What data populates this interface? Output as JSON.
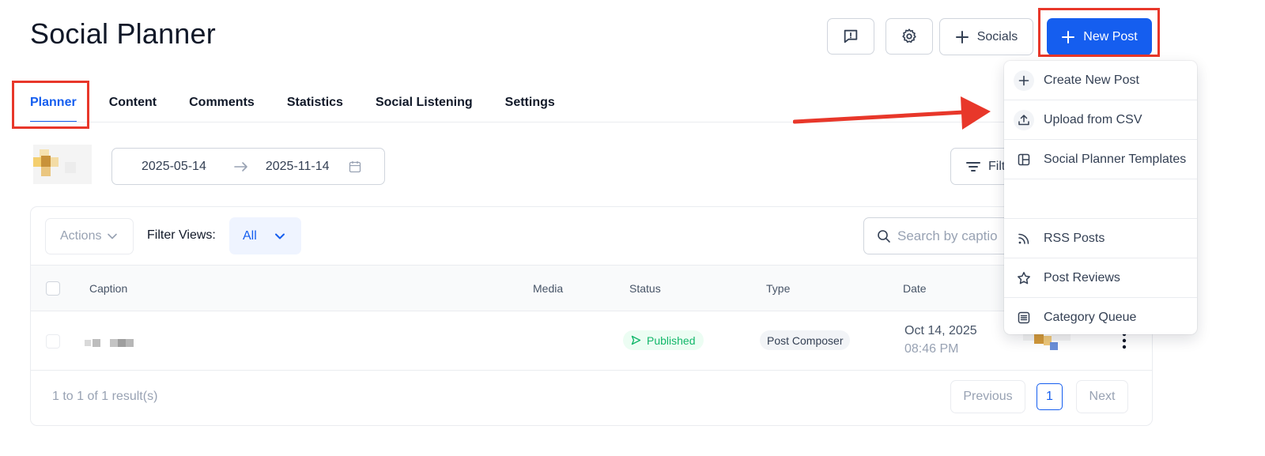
{
  "header": {
    "title": "Social Planner",
    "socials_label": "Socials",
    "new_post_label": "New Post"
  },
  "tabs": [
    {
      "label": "Planner",
      "active": true
    },
    {
      "label": "Content"
    },
    {
      "label": "Comments"
    },
    {
      "label": "Statistics"
    },
    {
      "label": "Social Listening"
    },
    {
      "label": "Settings"
    }
  ],
  "date_range": {
    "start": "2025-05-14",
    "end": "2025-11-14"
  },
  "filter_button": {
    "label": "Filt"
  },
  "toolbar": {
    "actions_label": "Actions",
    "filter_views_label": "Filter Views:",
    "filter_views_value": "All",
    "search_placeholder": "Search by captio"
  },
  "table": {
    "columns": [
      "Caption",
      "Media",
      "Status",
      "Type",
      "Date"
    ],
    "rows": [
      {
        "status": "Published",
        "type": "Post Composer",
        "date": "Oct 14, 2025",
        "time": "08:46 PM"
      }
    ]
  },
  "pagination": {
    "info": "1 to 1 of 1 result(s)",
    "previous": "Previous",
    "page": "1",
    "next": "Next"
  },
  "dropdown": {
    "items": [
      {
        "label": "Create New Post",
        "icon": "plus-icon"
      },
      {
        "label": "Upload from CSV",
        "icon": "upload-icon"
      },
      {
        "label": "Social Planner Templates",
        "icon": "template-icon"
      },
      {
        "label": "",
        "icon": ""
      },
      {
        "label": "RSS Posts",
        "icon": "rss-icon"
      },
      {
        "label": "Post Reviews",
        "icon": "star-icon"
      },
      {
        "label": "Category Queue",
        "icon": "list-icon"
      }
    ]
  },
  "colors": {
    "primary": "#155eef",
    "success": "#12b76a",
    "annotation": "#e8372a"
  }
}
